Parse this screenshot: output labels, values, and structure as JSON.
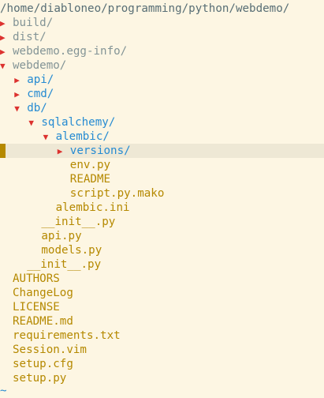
{
  "header": {
    "path": "/home/diabloneo/programming/python/webdemo/"
  },
  "symbols": {
    "collapsed": "▶",
    "expanded": "▼"
  },
  "tree": [
    {
      "name": "build/",
      "kind": "dir",
      "state": "collapsed",
      "depth": 0
    },
    {
      "name": "dist/",
      "kind": "dir",
      "state": "collapsed",
      "depth": 0
    },
    {
      "name": "webdemo.egg-info/",
      "kind": "dir",
      "state": "collapsed",
      "depth": 0
    },
    {
      "name": "webdemo/",
      "kind": "dir",
      "state": "expanded",
      "depth": 0
    },
    {
      "name": "api/",
      "kind": "dir",
      "state": "collapsed",
      "depth": 1
    },
    {
      "name": "cmd/",
      "kind": "dir",
      "state": "collapsed",
      "depth": 1
    },
    {
      "name": "db/",
      "kind": "dir",
      "state": "expanded",
      "depth": 1
    },
    {
      "name": "sqlalchemy/",
      "kind": "dir",
      "state": "expanded",
      "depth": 2
    },
    {
      "name": "alembic/",
      "kind": "dir",
      "state": "expanded",
      "depth": 3
    },
    {
      "name": "versions/",
      "kind": "dir",
      "state": "collapsed",
      "depth": 4,
      "selected": true
    },
    {
      "name": "env.py",
      "kind": "file",
      "depth": 4
    },
    {
      "name": "README",
      "kind": "file",
      "depth": 4
    },
    {
      "name": "script.py.mako",
      "kind": "file",
      "depth": 4
    },
    {
      "name": "alembic.ini",
      "kind": "file",
      "depth": 3
    },
    {
      "name": "__init__.py",
      "kind": "file",
      "depth": 2
    },
    {
      "name": "api.py",
      "kind": "file",
      "depth": 2
    },
    {
      "name": "models.py",
      "kind": "file",
      "depth": 2
    },
    {
      "name": "__init__.py",
      "kind": "file",
      "depth": 1
    },
    {
      "name": "AUTHORS",
      "kind": "file",
      "depth": 0
    },
    {
      "name": "ChangeLog",
      "kind": "file",
      "depth": 0
    },
    {
      "name": "LICENSE",
      "kind": "file",
      "depth": 0
    },
    {
      "name": "README.md",
      "kind": "file",
      "depth": 0
    },
    {
      "name": "requirements.txt",
      "kind": "file",
      "depth": 0
    },
    {
      "name": "Session.vim",
      "kind": "file",
      "depth": 0
    },
    {
      "name": "setup.cfg",
      "kind": "file",
      "depth": 0
    },
    {
      "name": "setup.py",
      "kind": "file",
      "depth": 0
    }
  ],
  "empty_line_marker": "~",
  "colors": {
    "background": "#fdf6e3",
    "cursor_line": "#eee8d5",
    "cursor": "#b58900",
    "arrow": "#dc322f",
    "dir_closed": "#839496",
    "dir_open": "#268bd2",
    "file": "#b58900",
    "tilde": "#268bd2"
  }
}
